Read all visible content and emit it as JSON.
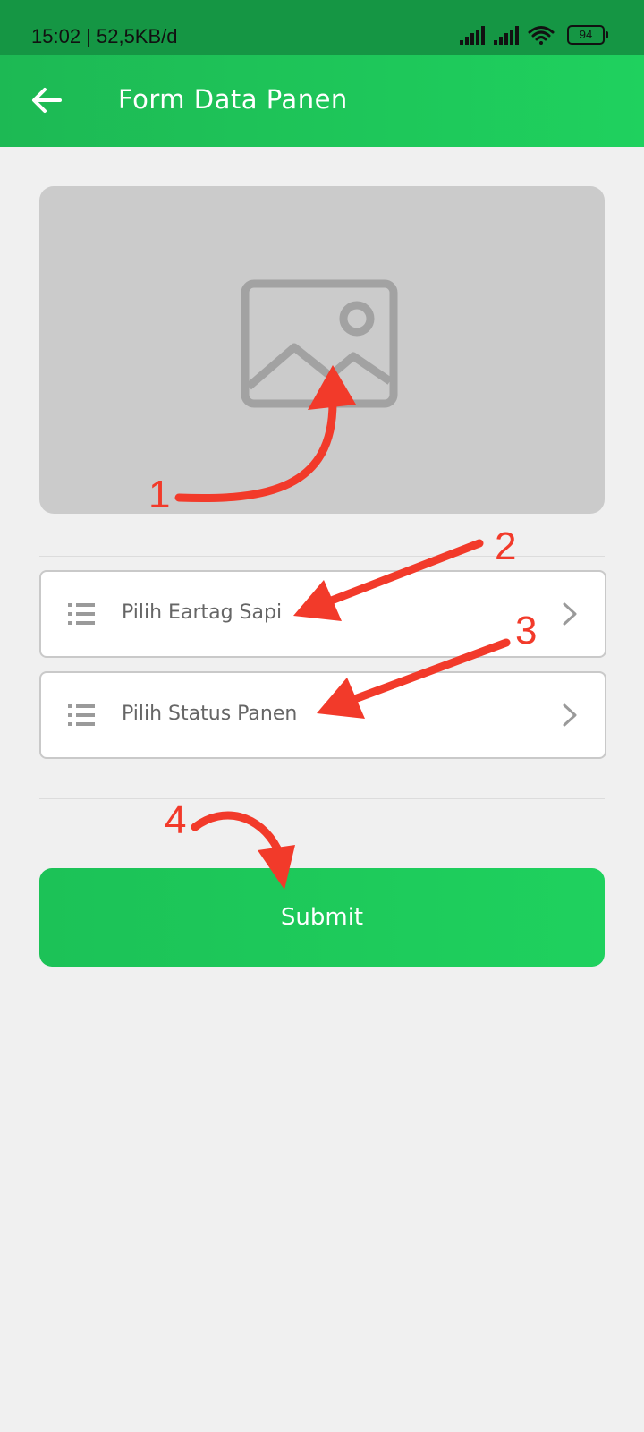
{
  "status_bar": {
    "time": "15:02 | 52,5KB/d",
    "battery": "94"
  },
  "app_bar": {
    "title": "Form Data Panen",
    "back_icon": "arrow-left-icon"
  },
  "image_picker": {
    "icon": "image-placeholder-icon"
  },
  "fields": [
    {
      "label": "Pilih Eartag Sapi",
      "icon": "list-icon"
    },
    {
      "label": "Pilih Status Panen",
      "icon": "list-icon"
    }
  ],
  "submit": {
    "label": "Submit"
  },
  "annotations": {
    "numbers": [
      "1",
      "2",
      "3",
      "4"
    ],
    "color": "#f23a2a"
  },
  "colors": {
    "primary": "#1fd15e",
    "status_bar": "#159644",
    "background": "#f0f0f0"
  }
}
